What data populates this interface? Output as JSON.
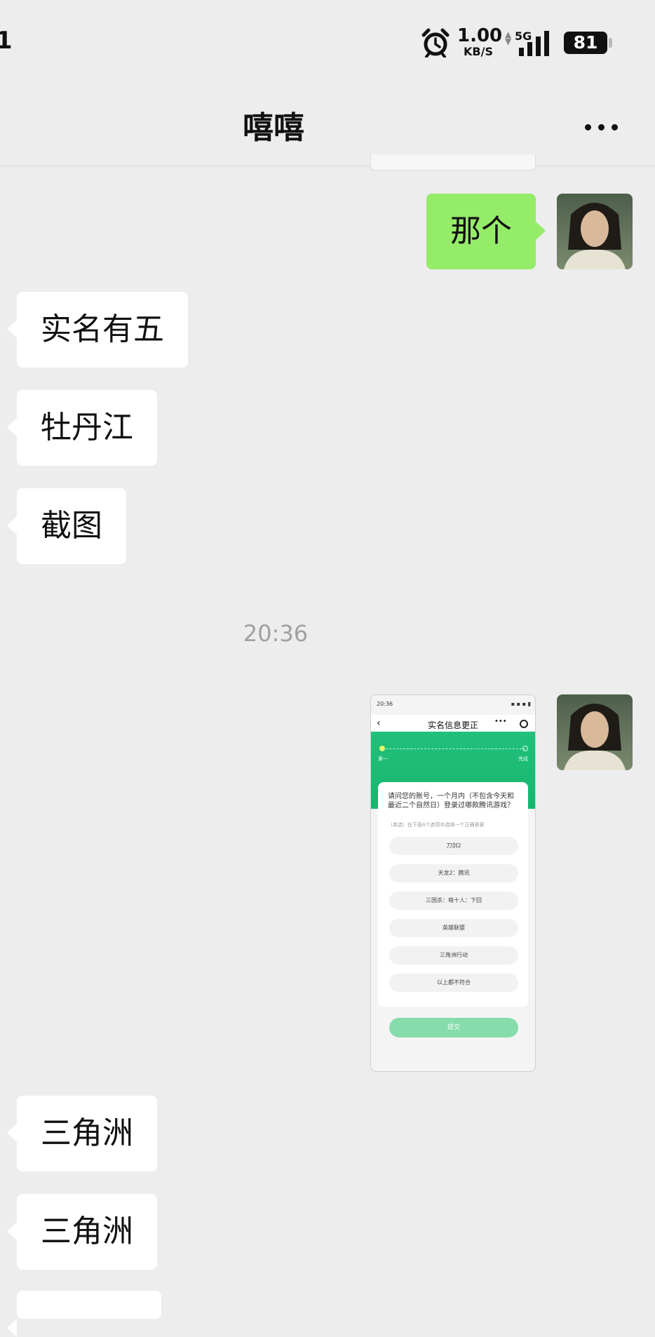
{
  "status_bar": {
    "time": "1",
    "net_speed_value": "1.00",
    "net_speed_unit": "KB/S",
    "network": "5G",
    "battery": "81"
  },
  "header": {
    "title": "嘻嘻",
    "more_icon": "more-icon"
  },
  "messages": [
    {
      "side": "right",
      "type": "text",
      "text": "那个"
    },
    {
      "side": "left",
      "type": "text",
      "text": "实名有五"
    },
    {
      "side": "left",
      "type": "text",
      "text": "牡丹江"
    },
    {
      "side": "left",
      "type": "text",
      "text": "截图"
    },
    {
      "type": "timestamp",
      "text": "20:36"
    },
    {
      "side": "right",
      "type": "image"
    },
    {
      "side": "left",
      "type": "text",
      "text": "三角洲"
    },
    {
      "side": "left",
      "type": "text",
      "text": "三角洲"
    }
  ],
  "thumbnail": {
    "status_time": "20:36",
    "nav_title": "实名信息更正",
    "step_left": "第一",
    "step_right": "完成",
    "question": "请问您的账号，一个月内（不包含今天和最近二个自然日）登录过哪款腾讯游戏？",
    "hint": "（单选）在下面4个选项中选择一个正确答案",
    "options": [
      "刀剑2",
      "天龙2：腾讯",
      "三国杀：萌十人：下回",
      "英雄联盟",
      "三角洲行动",
      "以上都不符合"
    ],
    "submit": "提交"
  },
  "colors": {
    "background": "#ededed",
    "sent_bubble": "#95ec69",
    "received_bubble": "#ffffff",
    "thumbnail_header": "#1fbd76"
  }
}
